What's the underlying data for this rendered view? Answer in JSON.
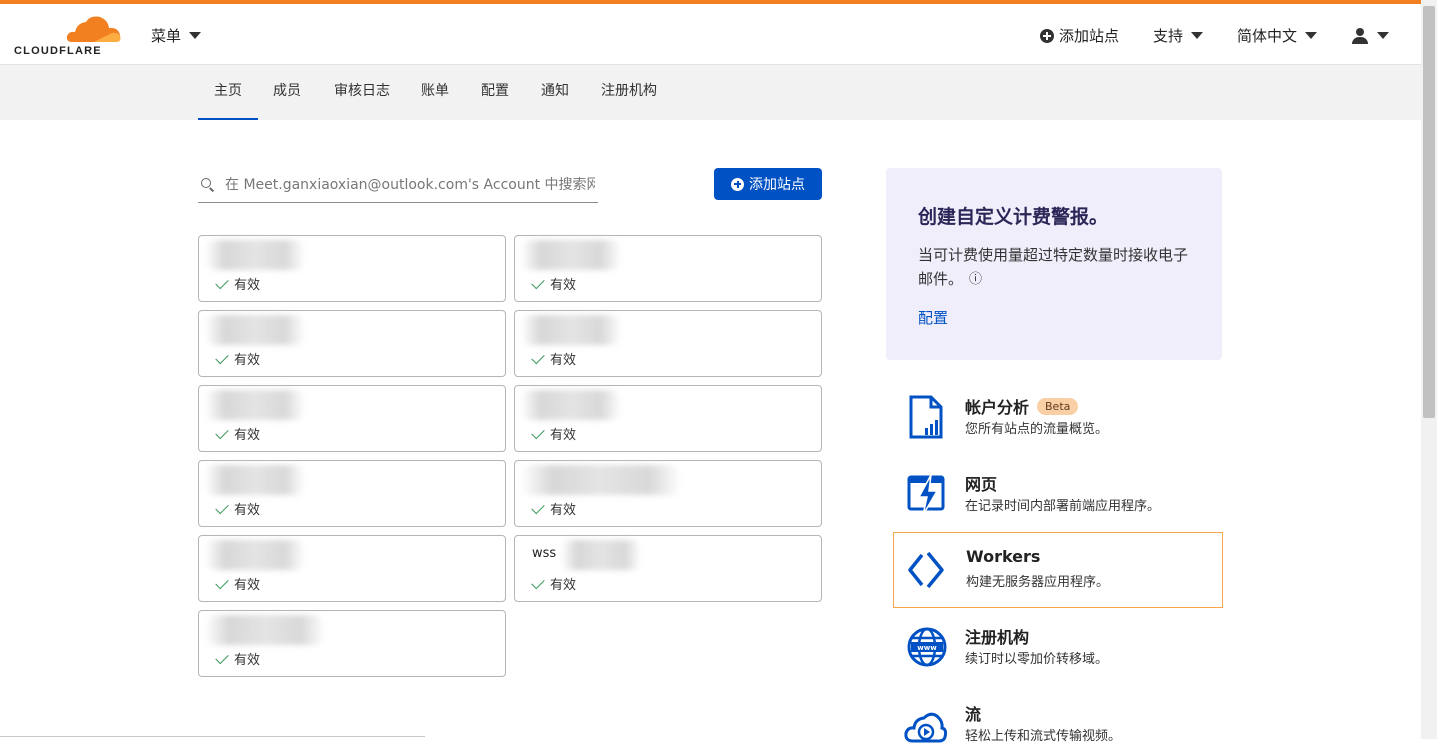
{
  "brand": {
    "logo_text": "CLOUDFLARE",
    "accent": "#f38020",
    "primary": "#0051c3"
  },
  "header": {
    "menu_label": "菜单",
    "add_site": "添加站点",
    "support": "支持",
    "language": "简体中文"
  },
  "tabs": [
    "主页",
    "成员",
    "审核日志",
    "账单",
    "配置",
    "通知",
    "注册机构"
  ],
  "search": {
    "placeholder": "在 Meet.ganxiaoxian@outlook.com's Account 中搜索网"
  },
  "add_site_button": "添加站点",
  "sites": [
    {
      "name": "",
      "status": "有效"
    },
    {
      "name": "",
      "status": "有效"
    },
    {
      "name": "",
      "status": "有效"
    },
    {
      "name": "",
      "status": "有效"
    },
    {
      "name": "",
      "status": "有效"
    },
    {
      "name": "",
      "status": "有效"
    },
    {
      "name": "",
      "status": "有效"
    },
    {
      "name": "",
      "status": "有效"
    },
    {
      "name": "",
      "status": "有效"
    },
    {
      "name": "wss",
      "status": "有效"
    },
    {
      "name": "",
      "status": "有效"
    }
  ],
  "alert": {
    "title": "创建自定义计费警报。",
    "body": "当可计费使用量超过特定数量时接收电子邮件。",
    "info_icon": "ⓘ",
    "link": "配置"
  },
  "products": [
    {
      "title": "帐户分析",
      "badge": "Beta",
      "desc": "您所有站点的流量概览。",
      "icon": "analytics-file-icon"
    },
    {
      "title": "网页",
      "badge": "",
      "desc": "在记录时间内部署前端应用程序。",
      "icon": "pages-bolt-icon"
    },
    {
      "title": "Workers",
      "badge": "",
      "desc": "构建无服务器应用程序。",
      "icon": "workers-chevrons-icon"
    },
    {
      "title": "注册机构",
      "badge": "",
      "desc": "续订时以零加价转移域。",
      "icon": "www-globe-icon"
    },
    {
      "title": "流",
      "badge": "",
      "desc": "轻松上传和流式传输视频。",
      "icon": "stream-cloud-play-icon"
    }
  ]
}
